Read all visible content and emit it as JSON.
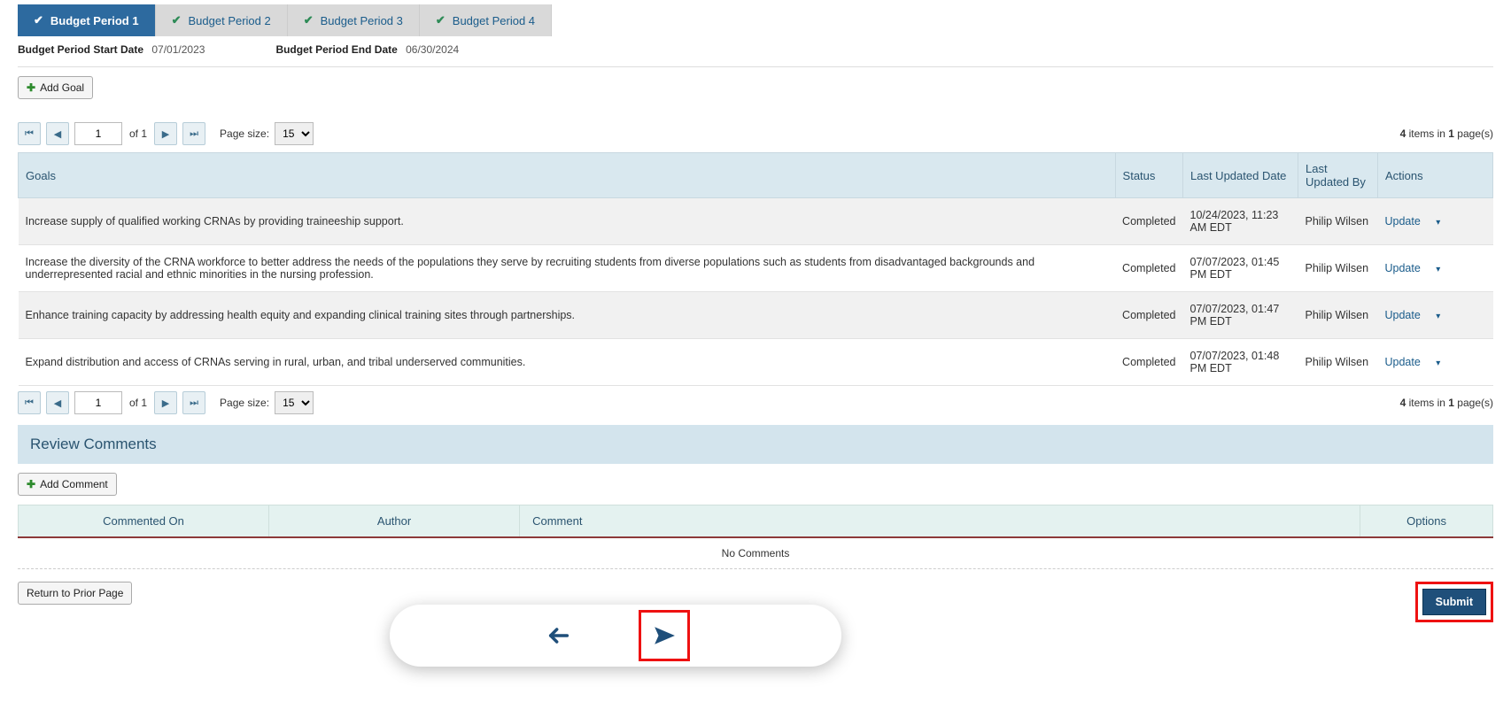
{
  "tabs": [
    {
      "label": "Budget Period 1",
      "active": true
    },
    {
      "label": "Budget Period 2",
      "active": false
    },
    {
      "label": "Budget Period 3",
      "active": false
    },
    {
      "label": "Budget Period 4",
      "active": false
    }
  ],
  "dates": {
    "start_label": "Budget Period Start Date",
    "start_value": "07/01/2023",
    "end_label": "Budget Period End Date",
    "end_value": "06/30/2024"
  },
  "buttons": {
    "add_goal": "Add Goal",
    "add_comment": "Add Comment",
    "return_prior": "Return to Prior Page",
    "submit": "Submit"
  },
  "pager": {
    "page_value": "1",
    "of_label": "of 1",
    "size_label": "Page size:",
    "size_value": "15",
    "summary_prefix": "",
    "items_count": "4",
    "items_word": " items in ",
    "pages_count": "1",
    "pages_word": " page(s)"
  },
  "goals_table": {
    "headers": {
      "goals": "Goals",
      "status": "Status",
      "last_updated_date": "Last Updated Date",
      "last_updated_by": "Last Updated By",
      "actions": "Actions"
    },
    "action_label": "Update",
    "rows": [
      {
        "goal": "Increase supply of qualified working CRNAs by providing traineeship support.",
        "status": "Completed",
        "date": "10/24/2023, 11:23 AM EDT",
        "by": "Philip Wilsen"
      },
      {
        "goal": "Increase the diversity of the CRNA workforce to better address the needs of the populations they serve by recruiting students from diverse populations such as students from disadvantaged backgrounds and underrepresented racial and ethnic minorities in the nursing profession.",
        "status": "Completed",
        "date": "07/07/2023, 01:45 PM EDT",
        "by": "Philip Wilsen"
      },
      {
        "goal": "Enhance training capacity by addressing health equity and expanding clinical training sites through partnerships.",
        "status": "Completed",
        "date": "07/07/2023, 01:47 PM EDT",
        "by": "Philip Wilsen"
      },
      {
        "goal": "Expand distribution and access of CRNAs serving in rural, urban, and tribal underserved communities.",
        "status": "Completed",
        "date": "07/07/2023, 01:48 PM EDT",
        "by": "Philip Wilsen"
      }
    ]
  },
  "review_header": "Review Comments",
  "comments_table": {
    "headers": {
      "commented_on": "Commented On",
      "author": "Author",
      "comment": "Comment",
      "options": "Options"
    },
    "no_comments": "No Comments"
  }
}
